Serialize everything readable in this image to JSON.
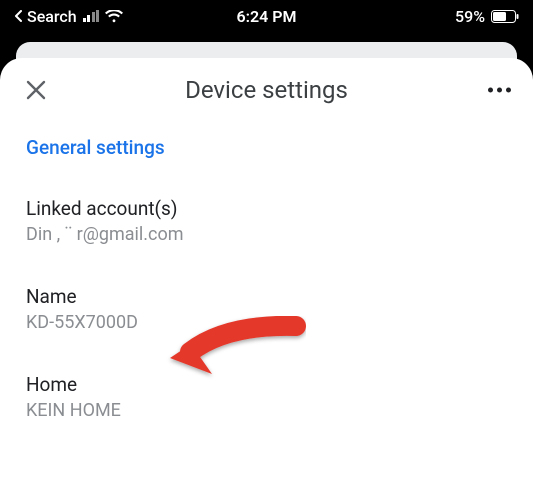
{
  "statusbar": {
    "back_label": "Search",
    "time": "6:24 PM",
    "battery_percent": "59%"
  },
  "header": {
    "title": "Device settings"
  },
  "sections": {
    "general_link": "General settings",
    "linked_accounts": {
      "label": "Linked account(s)",
      "value": "Din       , ¨     r@gmail.com"
    },
    "name": {
      "label": "Name",
      "value": "KD-55X7000D"
    },
    "home": {
      "label": "Home",
      "value": "KEIN HOME"
    }
  },
  "annotation": {
    "arrow_target": "device-name-value"
  }
}
